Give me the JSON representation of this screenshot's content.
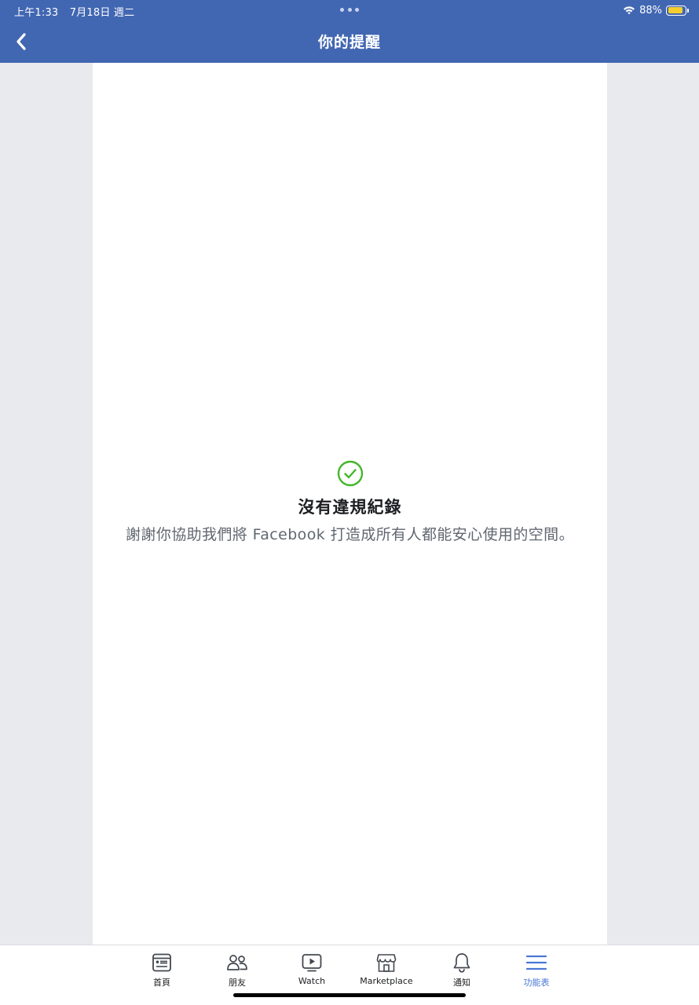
{
  "status_bar": {
    "time": "上午1:33",
    "date": "7月18日 週二",
    "battery": "88%",
    "battery_level": 0.88
  },
  "header": {
    "title": "你的提醒",
    "back_icon": "chevron-left-icon"
  },
  "empty_state": {
    "icon": "check-circle-icon",
    "title": "沒有違規紀錄",
    "description": "謝謝你協助我們將 Facebook 打造成所有人都能安心使用的空間。"
  },
  "tab_bar": {
    "tabs": [
      {
        "label": "首頁",
        "icon": "home-feed-icon",
        "active": false
      },
      {
        "label": "朋友",
        "icon": "friends-icon",
        "active": false
      },
      {
        "label": "Watch",
        "icon": "watch-icon",
        "active": false
      },
      {
        "label": "Marketplace",
        "icon": "marketplace-icon",
        "active": false
      },
      {
        "label": "通知",
        "icon": "bell-icon",
        "active": false
      },
      {
        "label": "功能表",
        "icon": "menu-icon",
        "active": true
      }
    ]
  },
  "colors": {
    "brand": "#4267b2",
    "check": "#42b72a",
    "active_tab": "#4a77d4",
    "battery": "#f7ce2b"
  }
}
